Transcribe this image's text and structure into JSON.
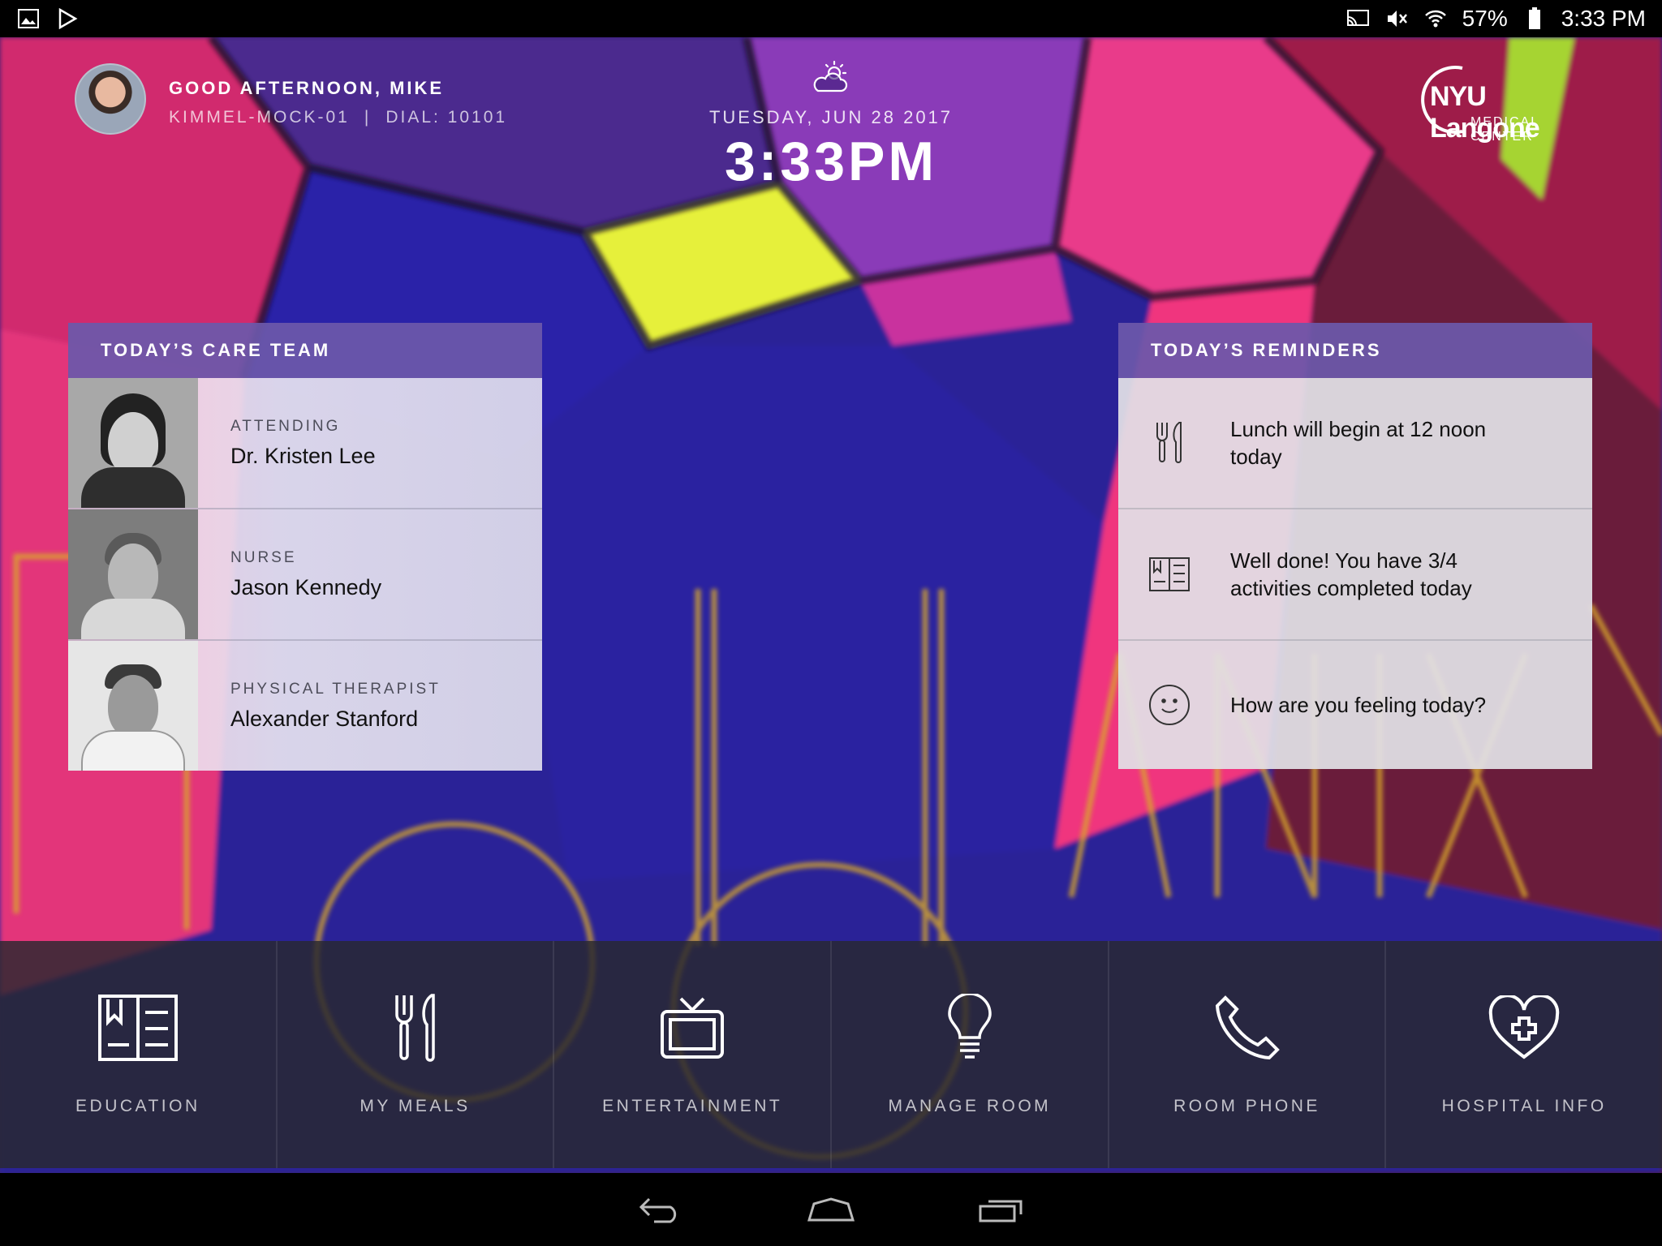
{
  "status_bar": {
    "battery": "57%",
    "time": "3:33 PM",
    "left_icons": [
      "image-icon",
      "play-store-icon"
    ],
    "right_icons": [
      "cast-icon",
      "mute-icon",
      "wifi-icon",
      "battery-icon"
    ]
  },
  "header": {
    "greeting": "GOOD AFTERNOON, MIKE",
    "room": "KIMMEL-MOCK-01",
    "separator": "|",
    "dial": "DIAL: 10101",
    "date": "TUESDAY, JUN 28 2017",
    "time": "3:33PM",
    "weather_icon": "partly-cloudy-icon",
    "logo_main": "NYU Langone",
    "logo_sub": "MEDICAL CENTER"
  },
  "care_team": {
    "title": "TODAY’S CARE TEAM",
    "members": [
      {
        "role": "ATTENDING",
        "name": "Dr. Kristen Lee"
      },
      {
        "role": "NURSE",
        "name": "Jason Kennedy"
      },
      {
        "role": "PHYSICAL THERAPIST",
        "name": "Alexander Stanford"
      }
    ]
  },
  "reminders": {
    "title": "TODAY’S REMINDERS",
    "items": [
      {
        "icon": "meal-icon",
        "text": "Lunch will begin at 12 noon today"
      },
      {
        "icon": "book-icon",
        "text": "Well done! You have 3/4 activities completed today"
      },
      {
        "icon": "smiley-icon",
        "text": "How are you feeling today?"
      }
    ]
  },
  "nav": [
    {
      "icon": "book-icon",
      "label": "EDUCATION"
    },
    {
      "icon": "fork-knife-icon",
      "label": "MY MEALS"
    },
    {
      "icon": "tv-icon",
      "label": "ENTERTAINMENT"
    },
    {
      "icon": "lightbulb-icon",
      "label": "MANAGE ROOM"
    },
    {
      "icon": "phone-icon",
      "label": "ROOM PHONE"
    },
    {
      "icon": "heart-plus-icon",
      "label": "HOSPITAL INFO"
    }
  ],
  "colors": {
    "panel_header": "#6c58aa",
    "nav_bg": "#28282e"
  }
}
